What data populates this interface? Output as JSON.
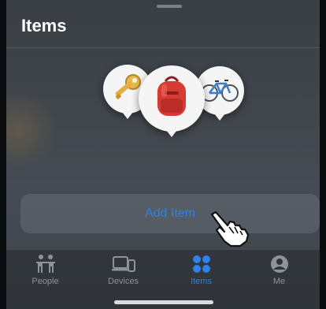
{
  "header": {
    "title": "Items"
  },
  "pins": [
    {
      "name": "key",
      "icon": "key-icon"
    },
    {
      "name": "backpack",
      "icon": "backpack-icon"
    },
    {
      "name": "bicycle",
      "icon": "bicycle-icon"
    }
  ],
  "action": {
    "add_item_label": "Add Item"
  },
  "tabs": [
    {
      "label": "People",
      "icon": "people-icon"
    },
    {
      "label": "Devices",
      "icon": "devices-icon"
    },
    {
      "label": "Items",
      "icon": "items-icon",
      "active": true
    },
    {
      "label": "Me",
      "icon": "me-icon"
    }
  ],
  "colors": {
    "accent": "#2f80e8",
    "inactive": "#8e939a"
  }
}
